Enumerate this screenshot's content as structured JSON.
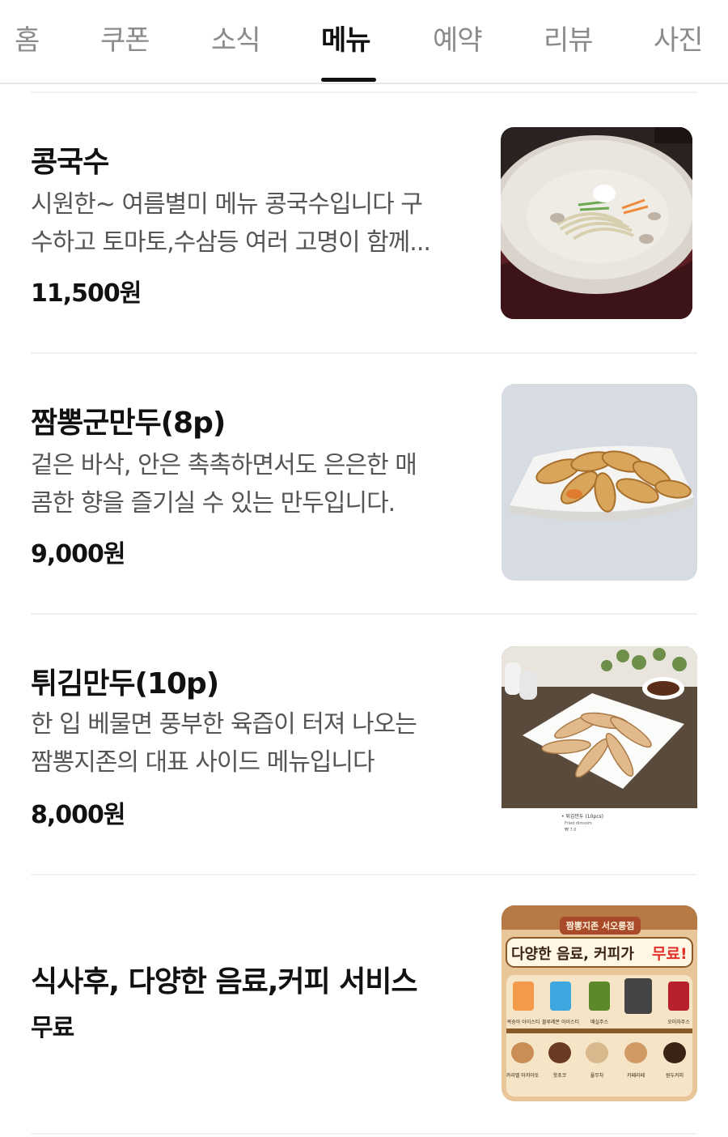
{
  "tabs": [
    {
      "label": "홈"
    },
    {
      "label": "쿠폰"
    },
    {
      "label": "소식"
    },
    {
      "label": "메뉴"
    },
    {
      "label": "예약"
    },
    {
      "label": "리뷰"
    },
    {
      "label": "사진"
    }
  ],
  "active_tab": "메뉴",
  "menu_items": [
    {
      "name": "콩국수",
      "description_lines": [
        "시원한~ 여름별미 메뉴 콩국수입니다 구",
        "수하고 토마토,수삼등 여러 고명이 함께..."
      ],
      "price": "11,500원",
      "image_icon": "kongguksu-photo-icon"
    },
    {
      "name": "짬뽕군만두(8p)",
      "description_lines": [
        "겉은 바삭, 안은 촉촉하면서도 은은한 매",
        "콤한 향을 즐기실 수 있는 만두입니다."
      ],
      "price": "9,000원",
      "image_icon": "fried-dumpling-photo-icon"
    },
    {
      "name": "튀김만두(10p)",
      "description_lines": [
        "한 입 베물면 풍부한 육즙이 터져 나오는",
        "짬뽕지존의 대표 사이드 메뉴입니다"
      ],
      "price": "8,000원",
      "image_icon": "deep-fried-dumpling-photo-icon"
    },
    {
      "name": "식사후, 다양한 음료,커피 서비스",
      "description_lines": [],
      "price": "무료",
      "image_icon": "drinks-poster-icon"
    }
  ],
  "poster": {
    "store_name": "짬뽕지존 서오릉점",
    "headline_main": "다양한 음료, 커피가",
    "headline_accent": "무료!",
    "drinks_row1": [
      "복숭아 아이스티",
      "블루레몬 아이스티",
      "매실주스",
      "",
      "오미자주스"
    ],
    "drinks_row2": [
      "카라멜 마끼아또",
      "핫초코",
      "율무차",
      "카페라떼",
      "원두커피"
    ]
  },
  "photo_caption": {
    "line1": "• 튀김만두 (10pcs)",
    "line2": "Fried dimsom",
    "line3": "₩ 7.0"
  },
  "colors": {
    "active_tab": "#111111",
    "inactive_tab": "#8b8b8b",
    "description": "#555555",
    "poster_accent": "#e2312b"
  }
}
